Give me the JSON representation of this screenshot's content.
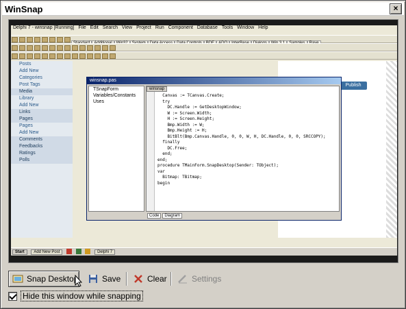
{
  "window": {
    "title": "WinSnap",
    "close_glyph": "×"
  },
  "preview": {
    "menubar": [
      "Delphi 7 - winsnap [Running]",
      "File",
      "Edit",
      "Search",
      "View",
      "Project",
      "Run",
      "Component",
      "Database",
      "Tools",
      "Window",
      "Help"
    ],
    "toolbar_tabs": [
      "Standard",
      "Additional",
      "Win32",
      "System",
      "Data Access",
      "Data Controls",
      "BDE",
      "ADO",
      "InterBase",
      "Dialogs",
      "Win 3.1",
      "Samples",
      "Rave"
    ],
    "wp_sidebar": [
      "Posts",
      "Add New",
      "Categories",
      "Post Tags",
      "Media",
      "Library",
      "Add New",
      "Links",
      "Pages",
      "Pages",
      "Add New",
      "Comments",
      "Feedbacks",
      "Ratings",
      "Polls"
    ],
    "publish_label": "Publish",
    "delphi_title": "winsnap.pas",
    "tree_items": [
      "TSnapForm",
      "Variables/Constants",
      "Uses"
    ],
    "code_tab": "winsnap",
    "code_lines": [
      "  Canvas := TCanvas.Create;",
      "  try",
      "    DC.Handle := GetDesktopWindow;",
      "    W := Screen.Width;",
      "    H := Screen.Height;",
      "    Bmp.Width := W;",
      "    Bmp.Height := H;",
      "    BitBlt(Bmp.Canvas.Handle, 0, 0, W, H, DC.Handle, 0, 0, SRCCOPY);",
      "  finally",
      "    DC.Free;",
      "  end;",
      "end;",
      "",
      "procedure TMainForm.SnapDesktop(Sender: TObject);",
      "var",
      "  Bitmap: TBitmap;",
      "begin"
    ],
    "status_tabs": [
      "Code",
      "Diagram"
    ],
    "taskbar": {
      "start": "Start",
      "items": [
        "Add New Post",
        "Delphi 7"
      ]
    }
  },
  "buttons": {
    "snap_desktop": "Snap Desktop",
    "save": "Save",
    "clear": "Clear",
    "settings": "Settings"
  },
  "options": {
    "hide_window": "Hide this window while snapping",
    "hide_window_checked": true
  },
  "colors": {
    "titlebar_bg": "#ffffff",
    "dialog_bg": "#d4d0c8",
    "preview_frame": "#1a1a1a",
    "clear_icon": "#c0392b",
    "save_icon": "#3a5fa0"
  }
}
